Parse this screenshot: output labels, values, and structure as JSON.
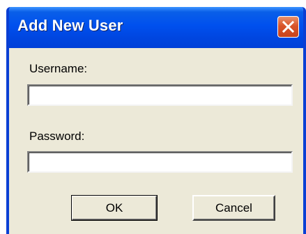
{
  "dialog": {
    "title": "Add New User",
    "close_icon": "close-icon",
    "username_label": "Username:",
    "username_value": "",
    "password_label": "Password:",
    "password_value": "",
    "ok_label": "OK",
    "cancel_label": "Cancel"
  },
  "colors": {
    "titlebar": "#0050ee",
    "window_body": "#ece9d8",
    "close_button": "#d9552a"
  }
}
